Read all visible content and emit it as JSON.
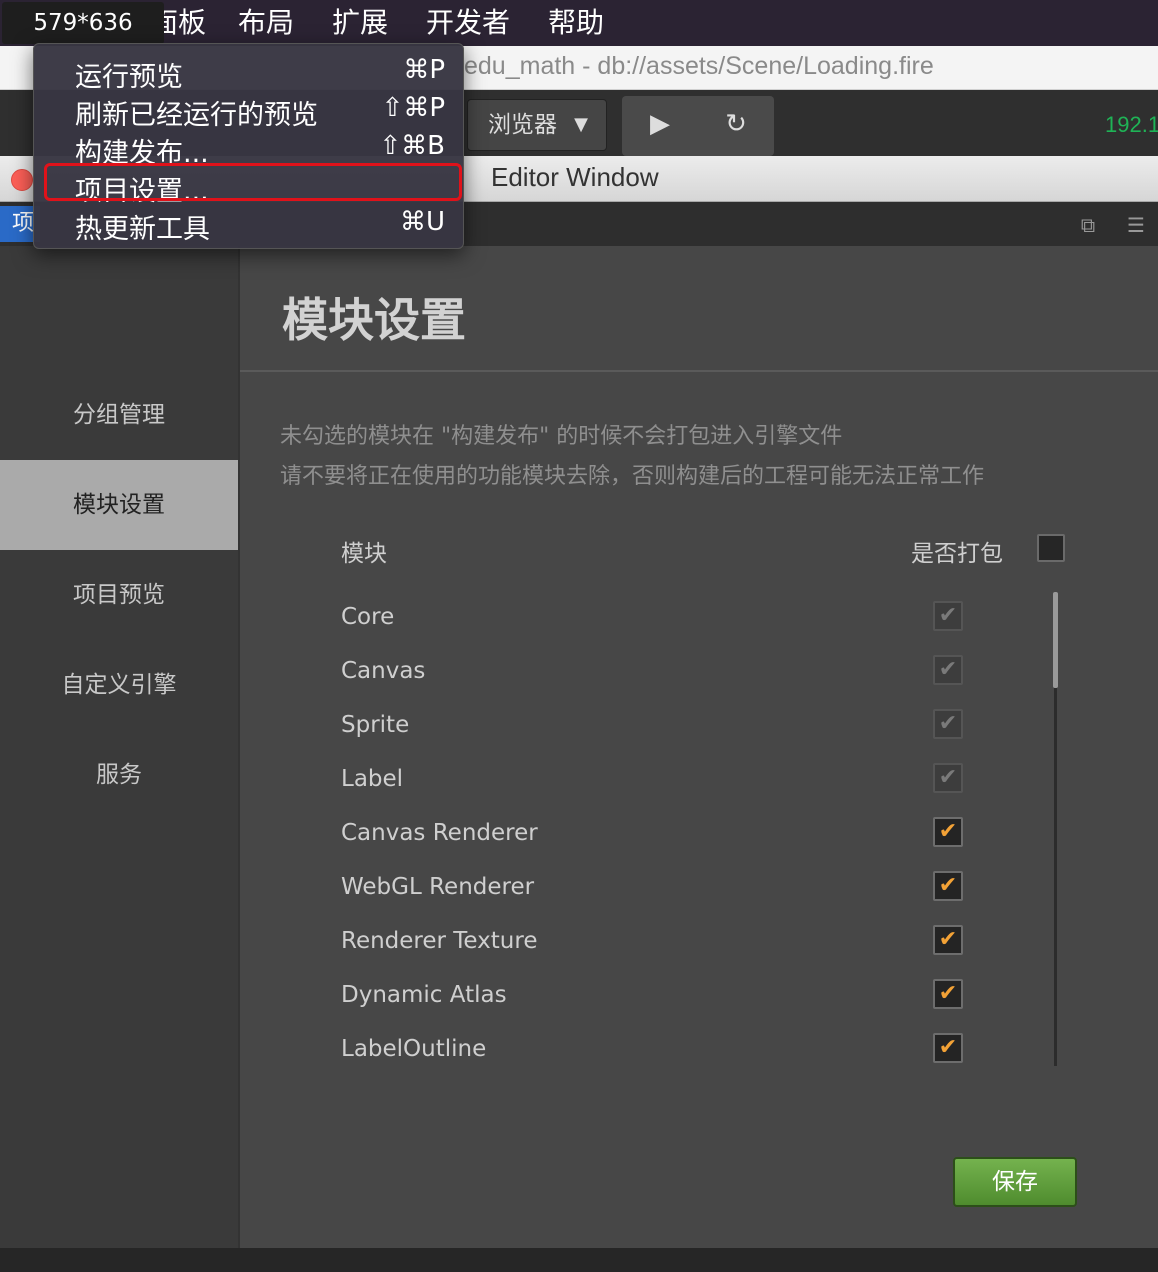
{
  "menubar": {
    "dims": "579*636",
    "items": [
      "面板",
      "布局",
      "扩展",
      "开发者",
      "帮助"
    ]
  },
  "address": {
    "path": "edu_math - db://assets/Scene/Loading.fire"
  },
  "toolbar": {
    "browser_label": "浏览器",
    "ip_text": "192.1"
  },
  "window": {
    "title": "Editor Window"
  },
  "tabstrip": {
    "active_tab": "项"
  },
  "dropdown": {
    "items": [
      {
        "label": "运行预览",
        "shortcut": "⌘P"
      },
      {
        "label": "刷新已经运行的预览",
        "shortcut": "⇧⌘P"
      },
      {
        "label": "构建发布...",
        "shortcut": "⇧⌘B"
      },
      {
        "label": "项目设置...",
        "shortcut": ""
      },
      {
        "label": "热更新工具",
        "shortcut": "⌘U"
      }
    ]
  },
  "sidebar": {
    "items": [
      {
        "label": "分组管理"
      },
      {
        "label": "模块设置",
        "active": true
      },
      {
        "label": "项目预览"
      },
      {
        "label": "自定义引擎"
      },
      {
        "label": "服务"
      }
    ]
  },
  "main": {
    "heading": "模块设置",
    "desc_line1": "未勾选的模块在 \"构建发布\" 的时候不会打包进入引擎文件",
    "desc_line2": "请不要将正在使用的功能模块去除，否则构建后的工程可能无法正常工作",
    "col_module": "模块",
    "col_pack": "是否打包",
    "pack_all_checked": false,
    "modules": [
      {
        "name": "Core",
        "checked": true,
        "locked": true
      },
      {
        "name": "Canvas",
        "checked": true,
        "locked": true
      },
      {
        "name": "Sprite",
        "checked": true,
        "locked": true
      },
      {
        "name": "Label",
        "checked": true,
        "locked": true
      },
      {
        "name": "Canvas Renderer",
        "checked": true,
        "locked": false
      },
      {
        "name": "WebGL Renderer",
        "checked": true,
        "locked": false
      },
      {
        "name": "Renderer Texture",
        "checked": true,
        "locked": false
      },
      {
        "name": "Dynamic Atlas",
        "checked": true,
        "locked": false
      },
      {
        "name": "LabelOutline",
        "checked": true,
        "locked": false
      }
    ],
    "save_label": "保存"
  },
  "colors": {
    "accent_check": "#f3a236",
    "save_green": "#5f9d3b",
    "highlight_red": "#e0121a",
    "ip_green": "#1fb356"
  }
}
